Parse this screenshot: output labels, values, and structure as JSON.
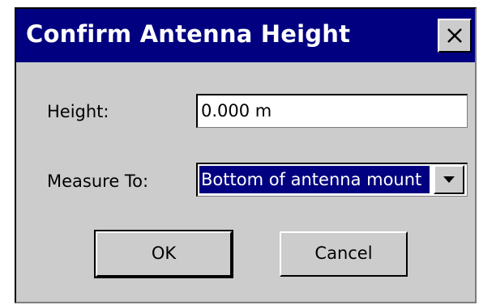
{
  "dialog": {
    "title": "Confirm Antenna Height",
    "close_icon": "close-icon"
  },
  "fields": {
    "height_label": "Height:",
    "height_value": "0.000 m",
    "measure_label": "Measure To:",
    "measure_value": "Bottom of antenna mount",
    "dropdown_icon": "chevron-down-icon"
  },
  "buttons": {
    "ok_label": "OK",
    "cancel_label": "Cancel"
  },
  "colors": {
    "titlebar": "#000080",
    "dialog_background": "#cccccc",
    "selection_background": "#000080"
  }
}
